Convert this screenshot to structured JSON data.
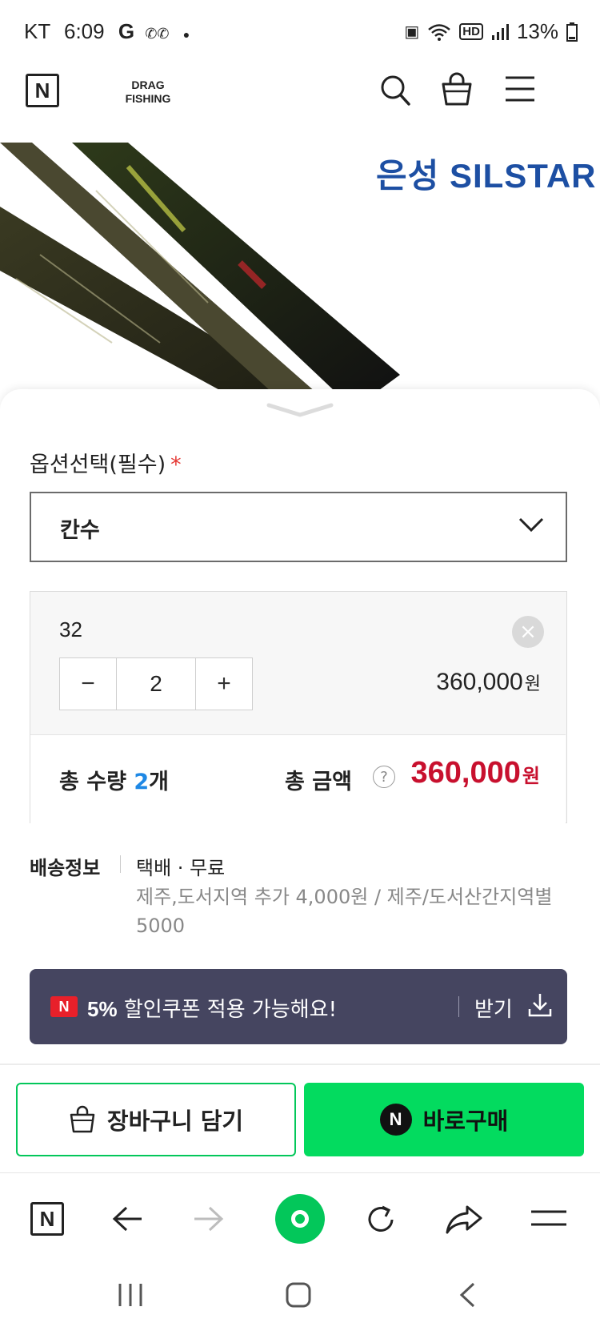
{
  "status_bar": {
    "carrier": "KT",
    "time": "6:09",
    "battery": "13%"
  },
  "header": {
    "logo_letter": "N",
    "brand_line1": "DRAG",
    "brand_line2": "FISHING"
  },
  "product_image": {
    "brand_logo_text": "은성 SILSTAR"
  },
  "option": {
    "title": "옵션선택(필수)",
    "required_mark": "*",
    "select_label": "칸수"
  },
  "selected_item": {
    "name": "32",
    "quantity": "2",
    "minus": "−",
    "plus": "+",
    "price": "360,000",
    "price_unit": "원"
  },
  "totals": {
    "qty_label": "총 수량",
    "qty_value": "2",
    "qty_unit": "개",
    "amount_label": "총 금액",
    "help": "?",
    "amount_value": "360,000",
    "amount_unit": "원"
  },
  "shipping": {
    "label": "배송정보",
    "method": "택배 · 무료",
    "detail": "제주,도서지역 추가 4,000원 / 제주/도서산간지역별 5000"
  },
  "coupon": {
    "badge": "N",
    "percent": "5%",
    "message": " 할인쿠폰 적용 가능해요!",
    "action": "받기"
  },
  "actions": {
    "cart_label": "장바구니 담기",
    "buy_badge": "N",
    "buy_label": "바로구매"
  },
  "browser_toolbar": {
    "home_letter": "N"
  },
  "colors": {
    "naver_green": "#03db5f",
    "price_red": "#c8102e",
    "coupon_bg": "#454560",
    "qty_blue": "#1e88e5"
  }
}
